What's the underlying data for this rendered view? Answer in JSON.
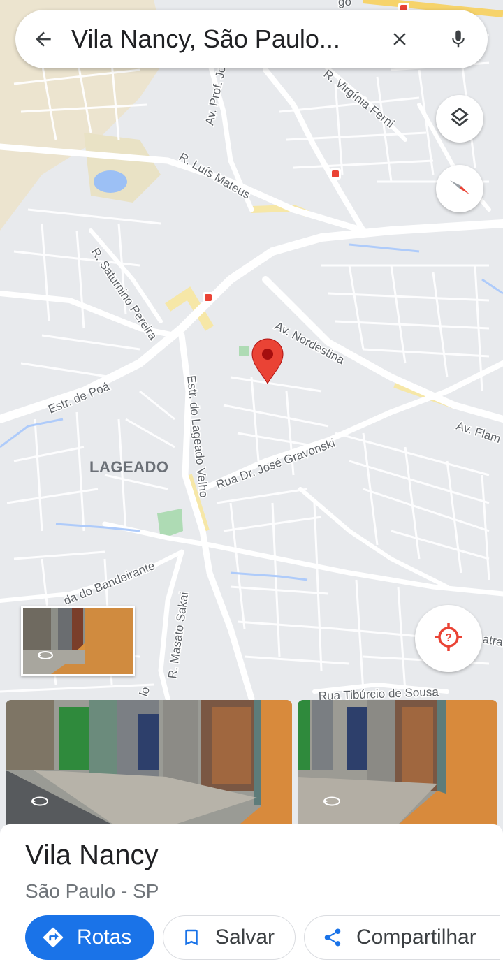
{
  "search": {
    "query": "Vila Nancy, São Paulo..."
  },
  "map": {
    "streets": [
      "R. Virgínia Ferni",
      "Av. Prof. Jo",
      "R. Luís Mateus",
      "R. Saturnino Pereira",
      "Av. Nordestina",
      "Estr. de Poá",
      "Estr. do Lageado Velho",
      "Av. Flam",
      "Rua Dr. José Gravonski",
      "da do Bandeirante",
      "R. Masato Sakai",
      "Rua Tibúrcio de Sousa",
      "go",
      "lo",
      "atrac"
    ],
    "area": "LAGEADO",
    "pin_color": "#ea4335"
  },
  "place": {
    "name": "Vila Nancy",
    "subtitle": "São Paulo - SP"
  },
  "actions": {
    "directions": "Rotas",
    "save": "Salvar",
    "share": "Compartilhar"
  },
  "colors": {
    "accent": "#1a73e8",
    "map_bg": "#e8eaed",
    "road": "#ffffff"
  }
}
